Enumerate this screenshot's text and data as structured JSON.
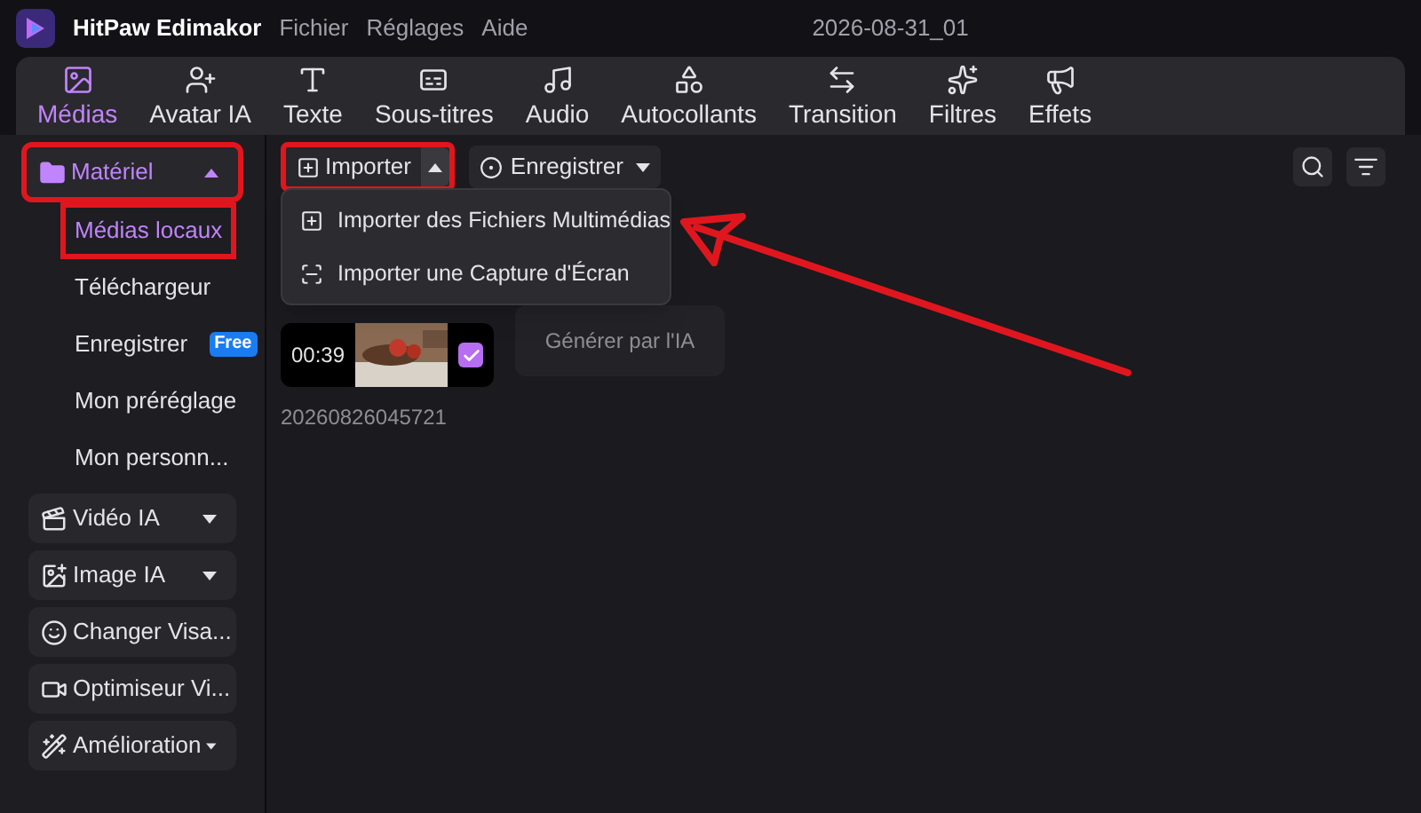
{
  "app": {
    "name": "HitPaw Edimakor",
    "menu": [
      "Fichier",
      "Réglages",
      "Aide"
    ],
    "project": "2026-08-31_01"
  },
  "tabs": [
    {
      "label": "Médias",
      "selected": true
    },
    {
      "label": "Avatar IA",
      "selected": false
    },
    {
      "label": "Texte",
      "selected": false
    },
    {
      "label": "Sous-titres",
      "selected": false
    },
    {
      "label": "Audio",
      "selected": false
    },
    {
      "label": "Autocollants",
      "selected": false
    },
    {
      "label": "Transition",
      "selected": false
    },
    {
      "label": "Filtres",
      "selected": false
    },
    {
      "label": "Effets",
      "selected": false
    }
  ],
  "sidebar": {
    "groups": [
      {
        "label": "Matériel",
        "expanded": true,
        "highlighted": true,
        "children": [
          {
            "label": "Médias locaux",
            "selected": true,
            "highlighted": true
          },
          {
            "label": "Téléchargeur",
            "selected": false,
            "highlighted": false
          },
          {
            "label": "Enregistrer",
            "badge": "Free",
            "selected": false,
            "highlighted": false
          },
          {
            "label": "Mon préréglage",
            "selected": false,
            "highlighted": false
          },
          {
            "label": "Mon personn...",
            "selected": false,
            "highlighted": false
          }
        ]
      },
      {
        "label": "Vidéo IA",
        "expanded": false,
        "highlighted": false
      },
      {
        "label": "Image IA",
        "expanded": false,
        "highlighted": false
      },
      {
        "label": "Changer Visa...",
        "expanded": false,
        "highlighted": false
      },
      {
        "label": "Optimiseur Vi...",
        "expanded": false,
        "highlighted": false
      },
      {
        "label": "Amélioration",
        "expanded": false,
        "highlighted": false
      }
    ]
  },
  "toolbar": {
    "import": {
      "label": "Importer",
      "expanded": true,
      "highlighted": true
    },
    "record": {
      "label": "Enregistrer"
    }
  },
  "import_menu": [
    "Importer des Fichiers Multimédias",
    "Importer une Capture d'Écran"
  ],
  "media": [
    {
      "duration": "00:39",
      "name": "20260826045721",
      "checked": true
    }
  ],
  "ai_card": {
    "label": "Générer par l'IA"
  }
}
